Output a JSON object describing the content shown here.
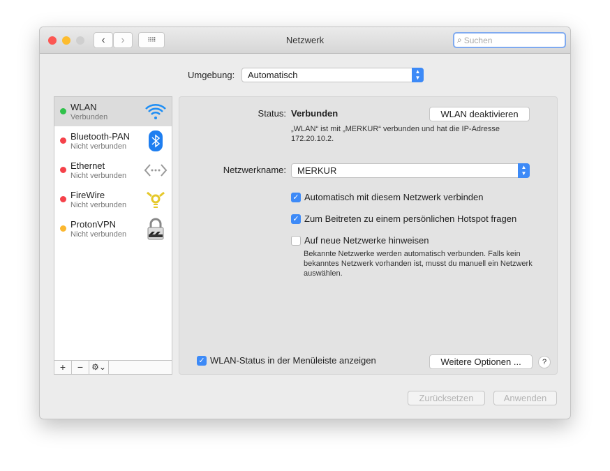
{
  "window": {
    "title": "Netzwerk",
    "search_placeholder": "Suchen"
  },
  "location": {
    "label": "Umgebung:",
    "value": "Automatisch"
  },
  "services": [
    {
      "name": "WLAN",
      "status": "Verbunden",
      "dot": "#2fc24a",
      "icon": "wifi-icon",
      "selected": true
    },
    {
      "name": "Bluetooth-PAN",
      "status": "Nicht verbunden",
      "dot": "#f5424a",
      "icon": "bluetooth-icon"
    },
    {
      "name": "Ethernet",
      "status": "Nicht verbunden",
      "dot": "#f5424a",
      "icon": "ethernet-icon"
    },
    {
      "name": "FireWire",
      "status": "Nicht verbunden",
      "dot": "#f5424a",
      "icon": "firewire-icon"
    },
    {
      "name": "ProtonVPN",
      "status": "Nicht verbunden",
      "dot": "#fbb72f",
      "icon": "vpn-lock-icon"
    }
  ],
  "sidebar_footer": {
    "add": "+",
    "remove": "−",
    "gear": "⚙⌄"
  },
  "detail": {
    "status_label": "Status:",
    "status_value": "Verbunden",
    "toggle_button": "WLAN deaktivieren",
    "status_desc_1": "„WLAN“ ist mit „MERKUR“ verbunden und hat die IP-Adresse",
    "status_desc_2": "172.20.10.2.",
    "network_label": "Netzwerkname:",
    "network_value": "MERKUR",
    "checks": [
      {
        "label": "Automatisch mit diesem Netzwerk verbinden",
        "checked": true
      },
      {
        "label": "Zum Beitreten zu einem persönlichen Hotspot fragen",
        "checked": true
      },
      {
        "label": "Auf neue Netzwerke hinweisen",
        "checked": false
      }
    ],
    "hint_1": "Bekannte Netzwerke werden automatisch verbunden. Falls kein",
    "hint_2": "bekanntes Netzwerk vorhanden ist, musst du manuell ein Netzwerk",
    "hint_3": "auswählen.",
    "menubar_check": {
      "label": "WLAN-Status in der Menüleiste anzeigen",
      "checked": true
    },
    "advanced_button": "Weitere Optionen ...",
    "help": "?"
  },
  "footer": {
    "revert": "Zurücksetzen",
    "apply": "Anwenden"
  }
}
